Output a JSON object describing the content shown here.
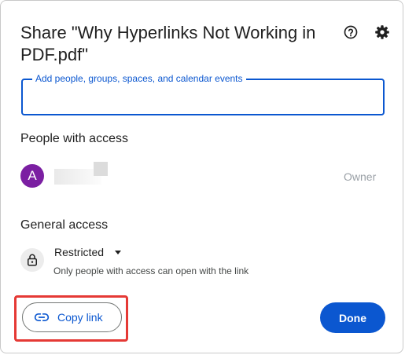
{
  "dialog": {
    "title": "Share \"Why Hyperlinks Not Working in PDF.pdf\""
  },
  "icons": {
    "help": "help-circle-icon",
    "settings": "gear-icon",
    "lock": "lock-icon",
    "link": "link-icon",
    "caret": "caret-down-icon"
  },
  "share_input": {
    "label": "Add people, groups, spaces, and calendar events",
    "value": ""
  },
  "people_section": {
    "heading": "People with access",
    "people": [
      {
        "avatar_initial": "A",
        "avatar_color": "#7b1fa2",
        "role": "Owner"
      }
    ]
  },
  "general_access": {
    "heading": "General access",
    "selected": "Restricted",
    "description": "Only people with access can open with the link"
  },
  "actions": {
    "copy_link": "Copy link",
    "done": "Done"
  },
  "colors": {
    "accent": "#0b57d0",
    "highlight": "#e53935"
  }
}
